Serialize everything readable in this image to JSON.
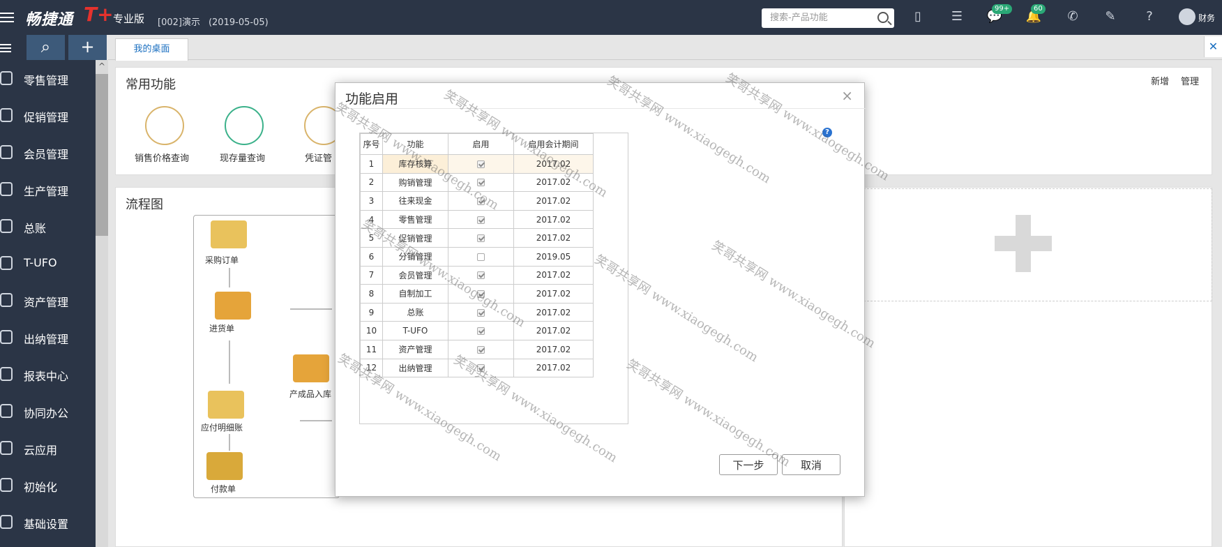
{
  "topbar": {
    "brand": "畅捷通",
    "brand_tplus": "T+",
    "edition": "专业版",
    "account": "[002]演示",
    "date": "(2019-05-05)",
    "search_placeholder": "搜索-产品功能",
    "messages_badge": "99+",
    "notifications_badge": "60",
    "user_name": "财务"
  },
  "sidebar": {
    "items": [
      {
        "label": "零售管理"
      },
      {
        "label": "促销管理"
      },
      {
        "label": "会员管理"
      },
      {
        "label": "生产管理"
      },
      {
        "label": "总账"
      },
      {
        "label": "T-UFO"
      },
      {
        "label": "资产管理"
      },
      {
        "label": "出纳管理"
      },
      {
        "label": "报表中心"
      },
      {
        "label": "协同办公"
      },
      {
        "label": "云应用"
      },
      {
        "label": "初始化"
      },
      {
        "label": "基础设置"
      }
    ]
  },
  "tabs": {
    "desktop": "我的桌面"
  },
  "common": {
    "title": "常用功能",
    "add": "新增",
    "manage": "管理",
    "items": [
      {
        "label": "销售价格查询"
      },
      {
        "label": "现存量查询"
      },
      {
        "label": "凭证管"
      }
    ]
  },
  "flow": {
    "title": "流程图",
    "nodes": [
      {
        "label": "采购订单"
      },
      {
        "label": "进货单"
      },
      {
        "label": "产成品入库"
      },
      {
        "label": "应付明细账"
      },
      {
        "label": "付款单"
      }
    ]
  },
  "modal": {
    "title": "功能启用",
    "close": "×",
    "columns": [
      "序号",
      "功能",
      "启用",
      "启用会计期间"
    ],
    "rows": [
      {
        "no": "1",
        "func": "库存核算",
        "enabled": true,
        "period": "2017.02"
      },
      {
        "no": "2",
        "func": "购销管理",
        "enabled": true,
        "period": "2017.02"
      },
      {
        "no": "3",
        "func": "往来现金",
        "enabled": true,
        "period": "2017.02"
      },
      {
        "no": "4",
        "func": "零售管理",
        "enabled": true,
        "period": "2017.02"
      },
      {
        "no": "5",
        "func": "促销管理",
        "enabled": true,
        "period": "2017.02"
      },
      {
        "no": "6",
        "func": "分销管理",
        "enabled": false,
        "period": "2019.05"
      },
      {
        "no": "7",
        "func": "会员管理",
        "enabled": true,
        "period": "2017.02"
      },
      {
        "no": "8",
        "func": "自制加工",
        "enabled": true,
        "period": "2017.02"
      },
      {
        "no": "9",
        "func": "总账",
        "enabled": true,
        "period": "2017.02"
      },
      {
        "no": "10",
        "func": "T-UFO",
        "enabled": true,
        "period": "2017.02"
      },
      {
        "no": "11",
        "func": "资产管理",
        "enabled": true,
        "period": "2017.02"
      },
      {
        "no": "12",
        "func": "出纳管理",
        "enabled": true,
        "period": "2017.02"
      }
    ],
    "next_button": "下一步",
    "cancel_button": "取消"
  },
  "watermark": "笑哥共享网 www.xiaogegh.com",
  "colors": {
    "topbar": "#2b3546",
    "accent": "#1a6fc0",
    "selected_row": "#fcefd8"
  }
}
